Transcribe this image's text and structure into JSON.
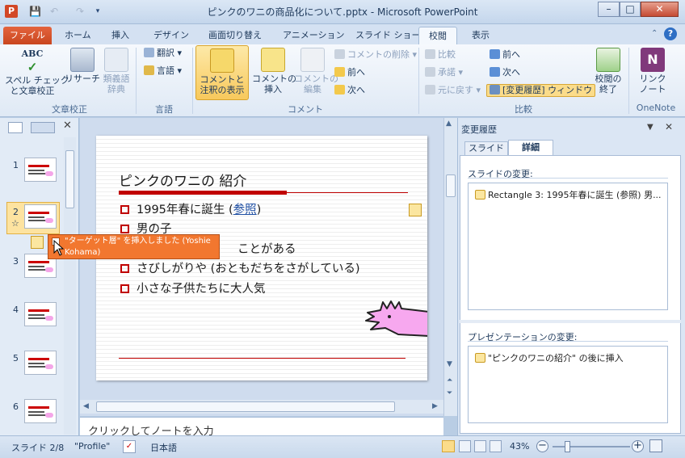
{
  "window": {
    "title": "ピンクのワニの商品化について.pptx - Microsoft PowerPoint",
    "app_icon": "P",
    "controls": {
      "minimize": "–",
      "maximize": "□",
      "close": "✕"
    }
  },
  "ribbon": {
    "tabs": [
      "ファイル",
      "ホーム",
      "挿入",
      "デザイン",
      "画面切り替え",
      "アニメーション",
      "スライド ショー",
      "校閲",
      "表示"
    ],
    "active_tab": "校閲",
    "groups": {
      "proofing": {
        "label": "文章校正",
        "abc_icon_text": "ABC",
        "spelling": "スペル チェック\nと文章校正",
        "research": "リサーチ",
        "thesaurus": "類義語\n辞典"
      },
      "language": {
        "label": "言語",
        "translate": "翻訳",
        "language": "言語"
      },
      "comments": {
        "label": "コメント",
        "show_markup": "コメントと\n注釈の表示",
        "new_comment": "コメントの\n挿入",
        "edit_comment": "コメントの\n編集",
        "delete": "コメントの削除",
        "prev": "前へ",
        "next": "次へ"
      },
      "compare": {
        "label": "比較",
        "compare": "比較",
        "accept": "承諾",
        "reject": "元に戻す",
        "prev": "前へ",
        "next": "次へ",
        "reviewing_pane": "[変更履歴] ウィンドウ",
        "end_review": "校閲の\n終了"
      },
      "onenote": {
        "label": "OneNote",
        "linked_notes": "リンク\nノート"
      }
    }
  },
  "slides_pane": {
    "thumbnails": [
      "1",
      "2",
      "3",
      "4",
      "5",
      "6"
    ],
    "selected": "2",
    "star": "☆",
    "popup_text": "\"ターゲット層\" を挿入しました (Yoshie Kohama)"
  },
  "slide": {
    "title": "ピンクのワニの 紹介",
    "bullets": [
      {
        "text": "1995年春に誕生 (",
        "link": "参照",
        "tail": ")"
      },
      {
        "text": "男の子"
      },
      {
        "text": "ことがある"
      },
      {
        "text": "さびしがりや (おともだちをさがしている)"
      },
      {
        "text": "小さな子供たちに大人気"
      }
    ]
  },
  "notes": {
    "placeholder": "クリックしてノートを入力"
  },
  "revisions_pane": {
    "title": "変更履歴",
    "tabs": [
      "スライド",
      "詳細"
    ],
    "active_tab": "詳細",
    "slide_changes_label": "スライドの変更:",
    "slide_changes": [
      "Rectangle 3: 1995年春に誕生 (参照) 男..."
    ],
    "presentation_changes_label": "プレゼンテーションの変更:",
    "presentation_changes": [
      "\"ピンクのワニの紹介\" の後に挿入"
    ]
  },
  "status_bar": {
    "slide_info": "スライド 2/8",
    "theme": "\"Profile\"",
    "language": "日本語",
    "zoom": "43%",
    "zoom_level": 0.43
  }
}
